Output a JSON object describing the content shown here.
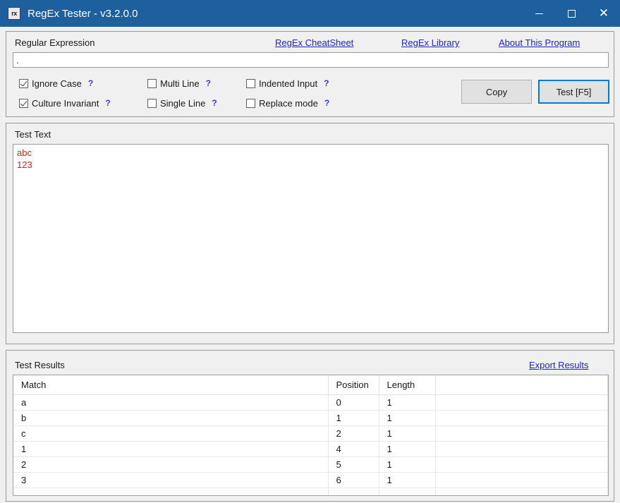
{
  "window": {
    "title": "RegEx Tester - v3.2.0.0",
    "icon_label": "rx",
    "icon_name": "regex-app-icon",
    "titlebar_color": "#1e5f9e",
    "controls": {
      "minimize": "–",
      "maximize": "□",
      "close": "✕"
    }
  },
  "regex_section": {
    "label": "Regular Expression",
    "input_value": ".",
    "input_placeholder": "",
    "links": [
      {
        "label": "RegEx CheatSheet",
        "name": "regex-cheatsheet-link"
      },
      {
        "label": "RegEx Library",
        "name": "regex-library-link"
      },
      {
        "label": "About This Program",
        "name": "about-this-program-link"
      }
    ],
    "options": [
      {
        "label": "Ignore Case",
        "checked": true,
        "help": "?"
      },
      {
        "label": "Culture Invariant",
        "checked": true,
        "help": "?"
      },
      {
        "label": "Multi Line",
        "checked": false,
        "help": "?"
      },
      {
        "label": "Single Line",
        "checked": false,
        "help": "?"
      },
      {
        "label": "Indented Input",
        "checked": false,
        "help": "?"
      },
      {
        "label": "Replace mode",
        "checked": false,
        "help": "?"
      }
    ],
    "buttons": {
      "copy": "Copy",
      "test": "Test [F5]"
    },
    "link_color": "#2222cc",
    "accent_color": "#0078d7"
  },
  "test_text_section": {
    "label": "Test Text",
    "value": "abc\n123",
    "text_color": "#e01b1b"
  },
  "results_section": {
    "label": "Test Results",
    "export_link": "Export Results",
    "columns": [
      "Match",
      "Position",
      "Length",
      ""
    ],
    "rows": [
      {
        "match": "a",
        "position": "0",
        "length": "1",
        "extra": ""
      },
      {
        "match": "b",
        "position": "1",
        "length": "1",
        "extra": ""
      },
      {
        "match": "c",
        "position": "2",
        "length": "1",
        "extra": ""
      },
      {
        "match": "1",
        "position": "4",
        "length": "1",
        "extra": ""
      },
      {
        "match": "2",
        "position": "5",
        "length": "1",
        "extra": ""
      },
      {
        "match": "3",
        "position": "6",
        "length": "1",
        "extra": ""
      },
      {
        "match": "",
        "position": "",
        "length": "",
        "extra": ""
      }
    ]
  }
}
